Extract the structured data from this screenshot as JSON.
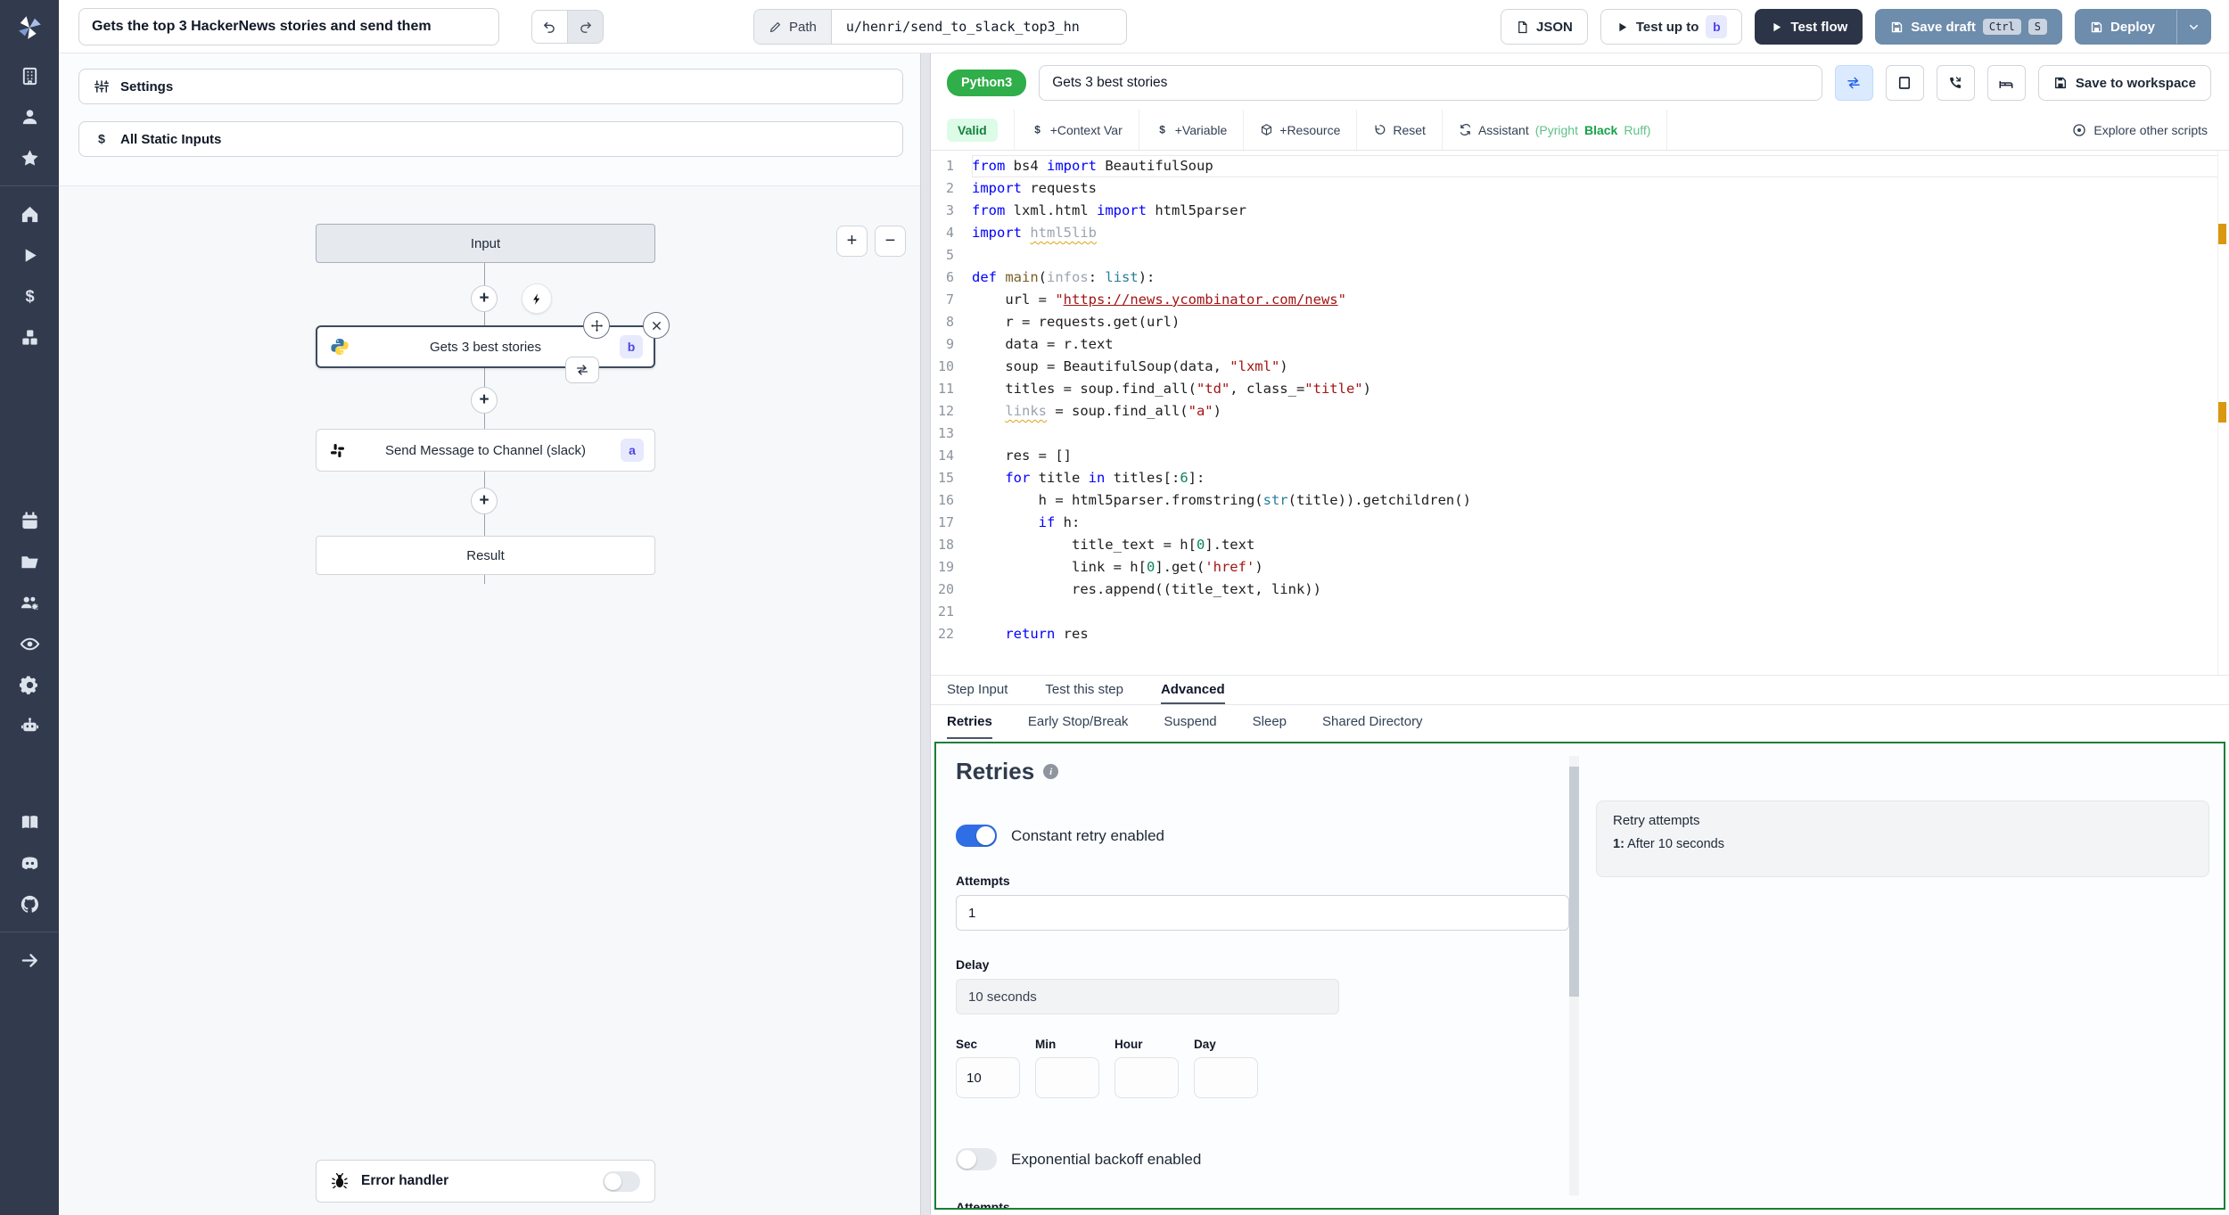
{
  "topbar": {
    "flow_title": "Gets the top 3 HackerNews stories and send them",
    "path_label": "Path",
    "path_value": "u/henri/send_to_slack_top3_hn",
    "json_button": "JSON",
    "test_up_to_label": "Test up to",
    "test_up_to_badge": "b",
    "test_flow_label": "Test flow",
    "save_draft_label": "Save draft",
    "save_draft_keys": {
      "k1": "Ctrl",
      "k2": "S"
    },
    "deploy_label": "Deploy"
  },
  "sidebar": {
    "icons": [
      "workspace-building",
      "user",
      "favorites-star",
      "home",
      "runs-play",
      "variables-dollar",
      "resources-cubes",
      "schedules-calendar",
      "folders",
      "groups-gear",
      "audit-eye",
      "settings-gear",
      "ai-robot",
      "docs-book",
      "discord",
      "github",
      "collapse-arrow-right"
    ]
  },
  "flow": {
    "settings_label": "Settings",
    "static_inputs_label": "All Static Inputs",
    "zoom_in": "+",
    "zoom_out": "−",
    "input_node": "Input",
    "step_b": {
      "label": "Gets 3 best stories",
      "badge": "b"
    },
    "step_a": {
      "label": "Send Message to Channel (slack)",
      "badge": "a"
    },
    "result_node": "Result",
    "error_handler_label": "Error handler"
  },
  "editor": {
    "lang_badge": "Python3",
    "step_name": "Gets 3 best stories",
    "toolbar": {
      "valid": "Valid",
      "context_var": "+Context Var",
      "variable": "+Variable",
      "resource": "+Resource",
      "reset": "Reset",
      "assistant": "Assistant",
      "assistant_pyright": "(Pyright",
      "assistant_black": "Black",
      "assistant_ruff": "Ruff)",
      "explore": "Explore other scripts",
      "save_workspace": "Save to workspace"
    },
    "code_lines": [
      {
        "n": "1",
        "segs": [
          [
            "kw",
            "from"
          ],
          [
            "t",
            " bs4 "
          ],
          [
            "kw",
            "import"
          ],
          [
            "t",
            " BeautifulSoup"
          ]
        ]
      },
      {
        "n": "2",
        "segs": [
          [
            "kw",
            "import"
          ],
          [
            "t",
            " requests"
          ]
        ]
      },
      {
        "n": "3",
        "segs": [
          [
            "kw",
            "from"
          ],
          [
            "t",
            " lxml.html "
          ],
          [
            "kw",
            "import"
          ],
          [
            "t",
            " html5parser"
          ]
        ]
      },
      {
        "n": "4",
        "segs": [
          [
            "kw",
            "import"
          ],
          [
            "t",
            " "
          ],
          [
            "dimsq",
            "html5lib"
          ]
        ]
      },
      {
        "n": "5",
        "segs": []
      },
      {
        "n": "6",
        "segs": [
          [
            "kw",
            "def"
          ],
          [
            "t",
            " "
          ],
          [
            "fn",
            "main"
          ],
          [
            "t",
            "("
          ],
          [
            "dim",
            "infos"
          ],
          [
            "t",
            ": "
          ],
          [
            "cls",
            "list"
          ],
          [
            "t",
            "):"
          ]
        ]
      },
      {
        "n": "7",
        "segs": [
          [
            "t",
            "    url = "
          ],
          [
            "str",
            "\""
          ],
          [
            "url",
            "https://news.ycombinator.com/news"
          ],
          [
            "str",
            "\""
          ]
        ]
      },
      {
        "n": "8",
        "segs": [
          [
            "t",
            "    r = requests.get(url)"
          ]
        ]
      },
      {
        "n": "9",
        "segs": [
          [
            "t",
            "    data = r.text"
          ]
        ]
      },
      {
        "n": "10",
        "segs": [
          [
            "t",
            "    soup = BeautifulSoup(data, "
          ],
          [
            "str",
            "\"lxml\""
          ],
          [
            "t",
            ")"
          ]
        ]
      },
      {
        "n": "11",
        "segs": [
          [
            "t",
            "    titles = soup.find_all("
          ],
          [
            "str",
            "\"td\""
          ],
          [
            "t",
            ", class_="
          ],
          [
            "str",
            "\"title\""
          ],
          [
            "t",
            ")"
          ]
        ]
      },
      {
        "n": "12",
        "segs": [
          [
            "t",
            "    "
          ],
          [
            "dimsq",
            "links"
          ],
          [
            "t",
            " = soup.find_all("
          ],
          [
            "str",
            "\"a\""
          ],
          [
            "t",
            ")"
          ]
        ]
      },
      {
        "n": "13",
        "segs": []
      },
      {
        "n": "14",
        "segs": [
          [
            "t",
            "    res = []"
          ]
        ]
      },
      {
        "n": "15",
        "segs": [
          [
            "t",
            "    "
          ],
          [
            "kw",
            "for"
          ],
          [
            "t",
            " title "
          ],
          [
            "kw",
            "in"
          ],
          [
            "t",
            " titles[:"
          ],
          [
            "num",
            "6"
          ],
          [
            "t",
            "]:"
          ]
        ]
      },
      {
        "n": "16",
        "segs": [
          [
            "t",
            "        h = html5parser.fromstring("
          ],
          [
            "cls",
            "str"
          ],
          [
            "t",
            "(title)).getchildren()"
          ]
        ]
      },
      {
        "n": "17",
        "segs": [
          [
            "t",
            "        "
          ],
          [
            "kw",
            "if"
          ],
          [
            "t",
            " h:"
          ]
        ]
      },
      {
        "n": "18",
        "segs": [
          [
            "t",
            "            title_text = h["
          ],
          [
            "num",
            "0"
          ],
          [
            "t",
            "].text"
          ]
        ]
      },
      {
        "n": "19",
        "segs": [
          [
            "t",
            "            link = h["
          ],
          [
            "num",
            "0"
          ],
          [
            "t",
            "].get("
          ],
          [
            "str",
            "'href'"
          ],
          [
            "t",
            ")"
          ]
        ]
      },
      {
        "n": "20",
        "segs": [
          [
            "t",
            "            res.append((title_text, link))"
          ]
        ]
      },
      {
        "n": "21",
        "segs": []
      },
      {
        "n": "22",
        "segs": [
          [
            "t",
            "    "
          ],
          [
            "kw",
            "return"
          ],
          [
            "t",
            " res"
          ]
        ]
      }
    ]
  },
  "tabs": {
    "main": [
      "Step Input",
      "Test this step",
      "Advanced"
    ],
    "main_active": "Advanced",
    "sub": [
      "Retries",
      "Early Stop/Break",
      "Suspend",
      "Sleep",
      "Shared Directory"
    ],
    "sub_active": "Retries"
  },
  "retries": {
    "heading": "Retries",
    "constant_label": "Constant retry enabled",
    "constant_enabled": true,
    "attempts_label": "Attempts",
    "attempts_value": "1",
    "delay_label": "Delay",
    "delay_value": "10 seconds",
    "unit_labels": [
      "Sec",
      "Min",
      "Hour",
      "Day"
    ],
    "sec_value": "10",
    "min_value": "",
    "hour_value": "",
    "day_value": "",
    "backoff_label": "Exponential backoff enabled",
    "backoff_enabled": false,
    "attempts2_label": "Attempts",
    "summary": {
      "title": "Retry attempts",
      "index": "1:",
      "text": "After 10 seconds"
    }
  },
  "colors": {
    "sidebar_bg": "#323b4e",
    "primary_button_blue": "#6e8cab",
    "dark_button": "#2b3547",
    "badge_indigo_bg": "#e7e9fd",
    "badge_indigo_text": "#4f46e5",
    "lang_badge_green": "#2fae49",
    "valid_bg": "#dcfce7",
    "valid_text": "#15803d",
    "panel_border_green": "#1a7f37",
    "toggle_on_blue": "#2f6ee4",
    "warning_marker_orange": "#d9980d"
  }
}
